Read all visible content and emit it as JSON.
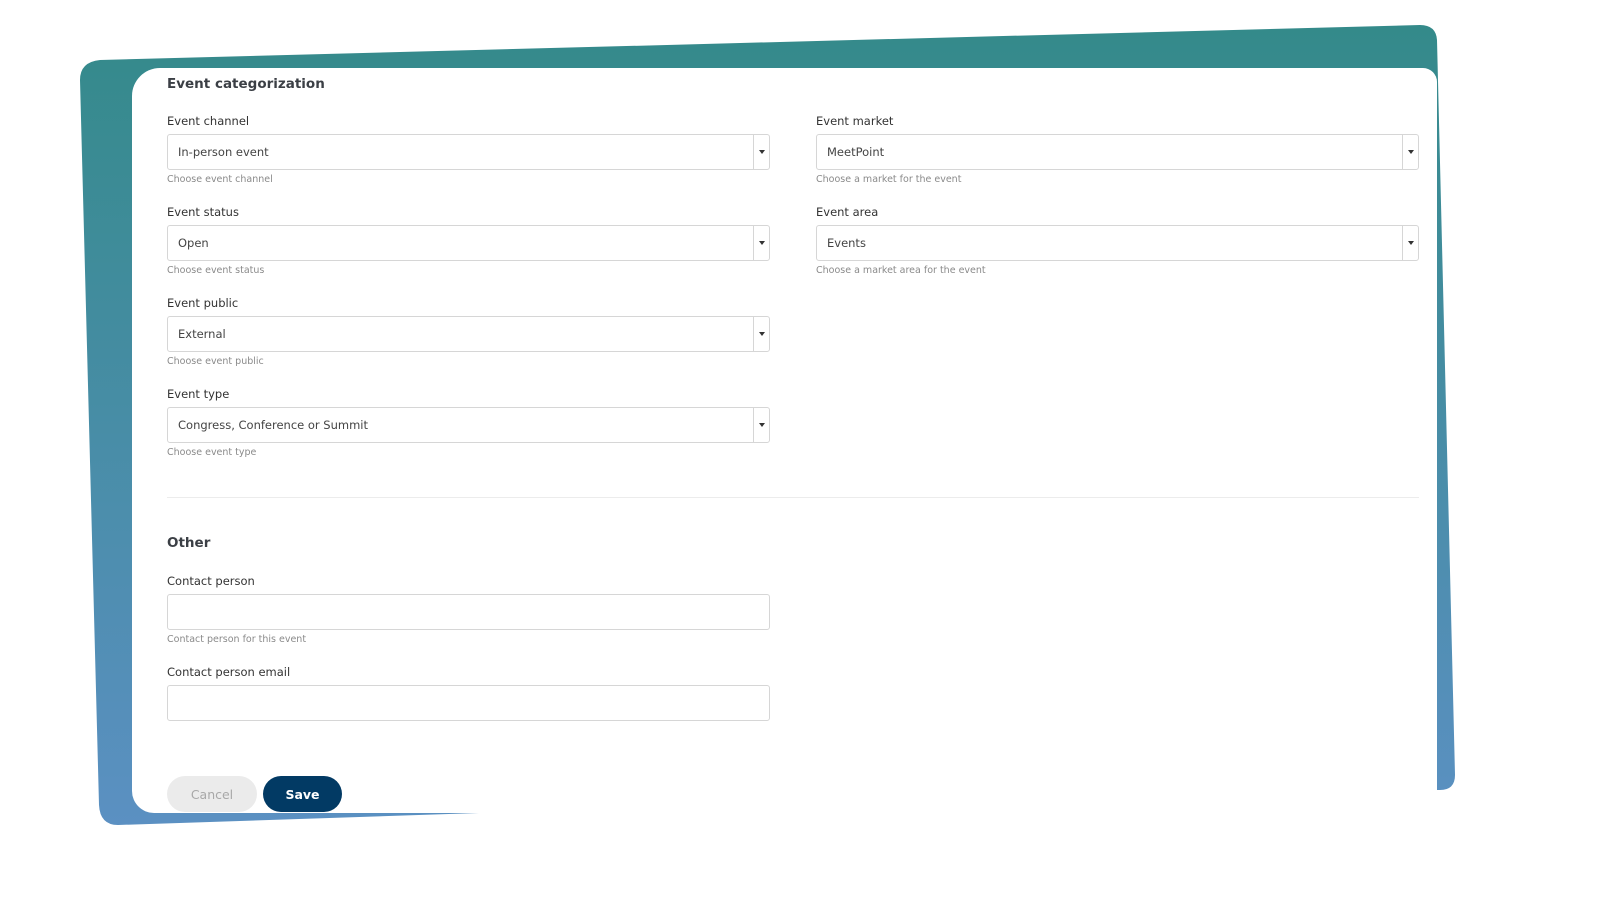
{
  "colors": {
    "gradient_top": "#348a8a",
    "gradient_bottom": "#5b90c2",
    "save": "#023a64",
    "cancel": "#ebebeb"
  },
  "sections": {
    "categorization": "Event categorization",
    "other": "Other"
  },
  "fields": {
    "channel": {
      "label": "Event channel",
      "value": "In-person event",
      "hint": "Choose event channel"
    },
    "status": {
      "label": "Event status",
      "value": "Open",
      "hint": "Choose event status"
    },
    "public": {
      "label": "Event public",
      "value": "External",
      "hint": "Choose event public"
    },
    "type": {
      "label": "Event type",
      "value": "Congress, Conference or Summit",
      "hint": "Choose event type"
    },
    "market": {
      "label": "Event market",
      "value": "MeetPoint",
      "hint": "Choose a market for the event"
    },
    "area": {
      "label": "Event area",
      "value": "Events",
      "hint": "Choose a market area for the event"
    },
    "contact": {
      "label": "Contact person",
      "value": "",
      "hint": "Contact person for this event"
    },
    "email": {
      "label": "Contact person email",
      "value": ""
    }
  },
  "buttons": {
    "cancel": "Cancel",
    "save": "Save"
  }
}
